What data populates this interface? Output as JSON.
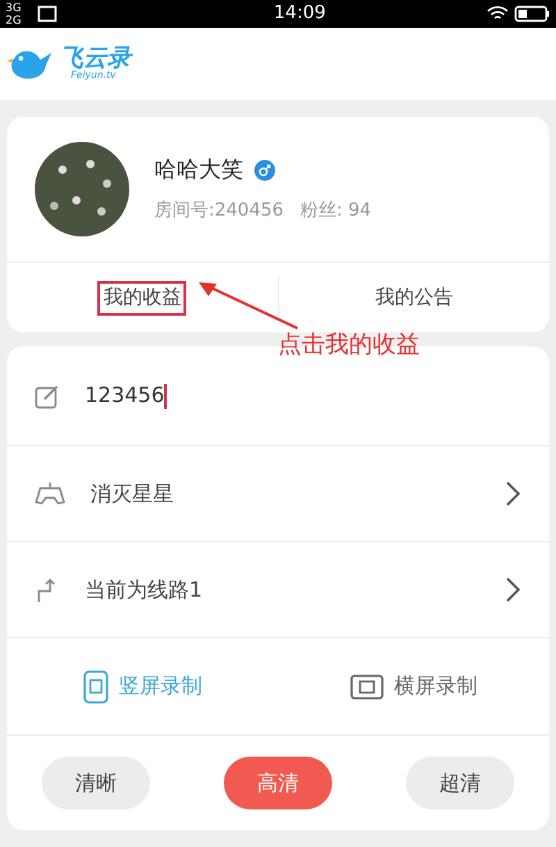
{
  "status_bar": {
    "network_1": "3G",
    "network_2": "2G",
    "time": "14:09"
  },
  "header": {
    "logo_text": "飞云录",
    "logo_subtext": "Feiyun.tv"
  },
  "profile": {
    "name": "哈哈大笑",
    "room": "房间号:240456",
    "fans": "粉丝: 94"
  },
  "tabs": [
    {
      "label": "我的收益",
      "highlighted": true
    },
    {
      "label": "我的公告",
      "highlighted": false
    }
  ],
  "annotation": {
    "text": "点击我的收益"
  },
  "title_field": {
    "value": "123456"
  },
  "menu": [
    {
      "kind": "game",
      "label": "消灭星星"
    },
    {
      "kind": "route",
      "label": "当前为线路1"
    }
  ],
  "orientation": [
    {
      "kind": "portrait",
      "label": "竖屏录制",
      "selected": true
    },
    {
      "kind": "landscape",
      "label": "横屏录制",
      "selected": false
    }
  ],
  "quality": [
    {
      "label": "清晰",
      "selected": false
    },
    {
      "label": "高清",
      "selected": true
    },
    {
      "label": "超清",
      "selected": false
    }
  ]
}
